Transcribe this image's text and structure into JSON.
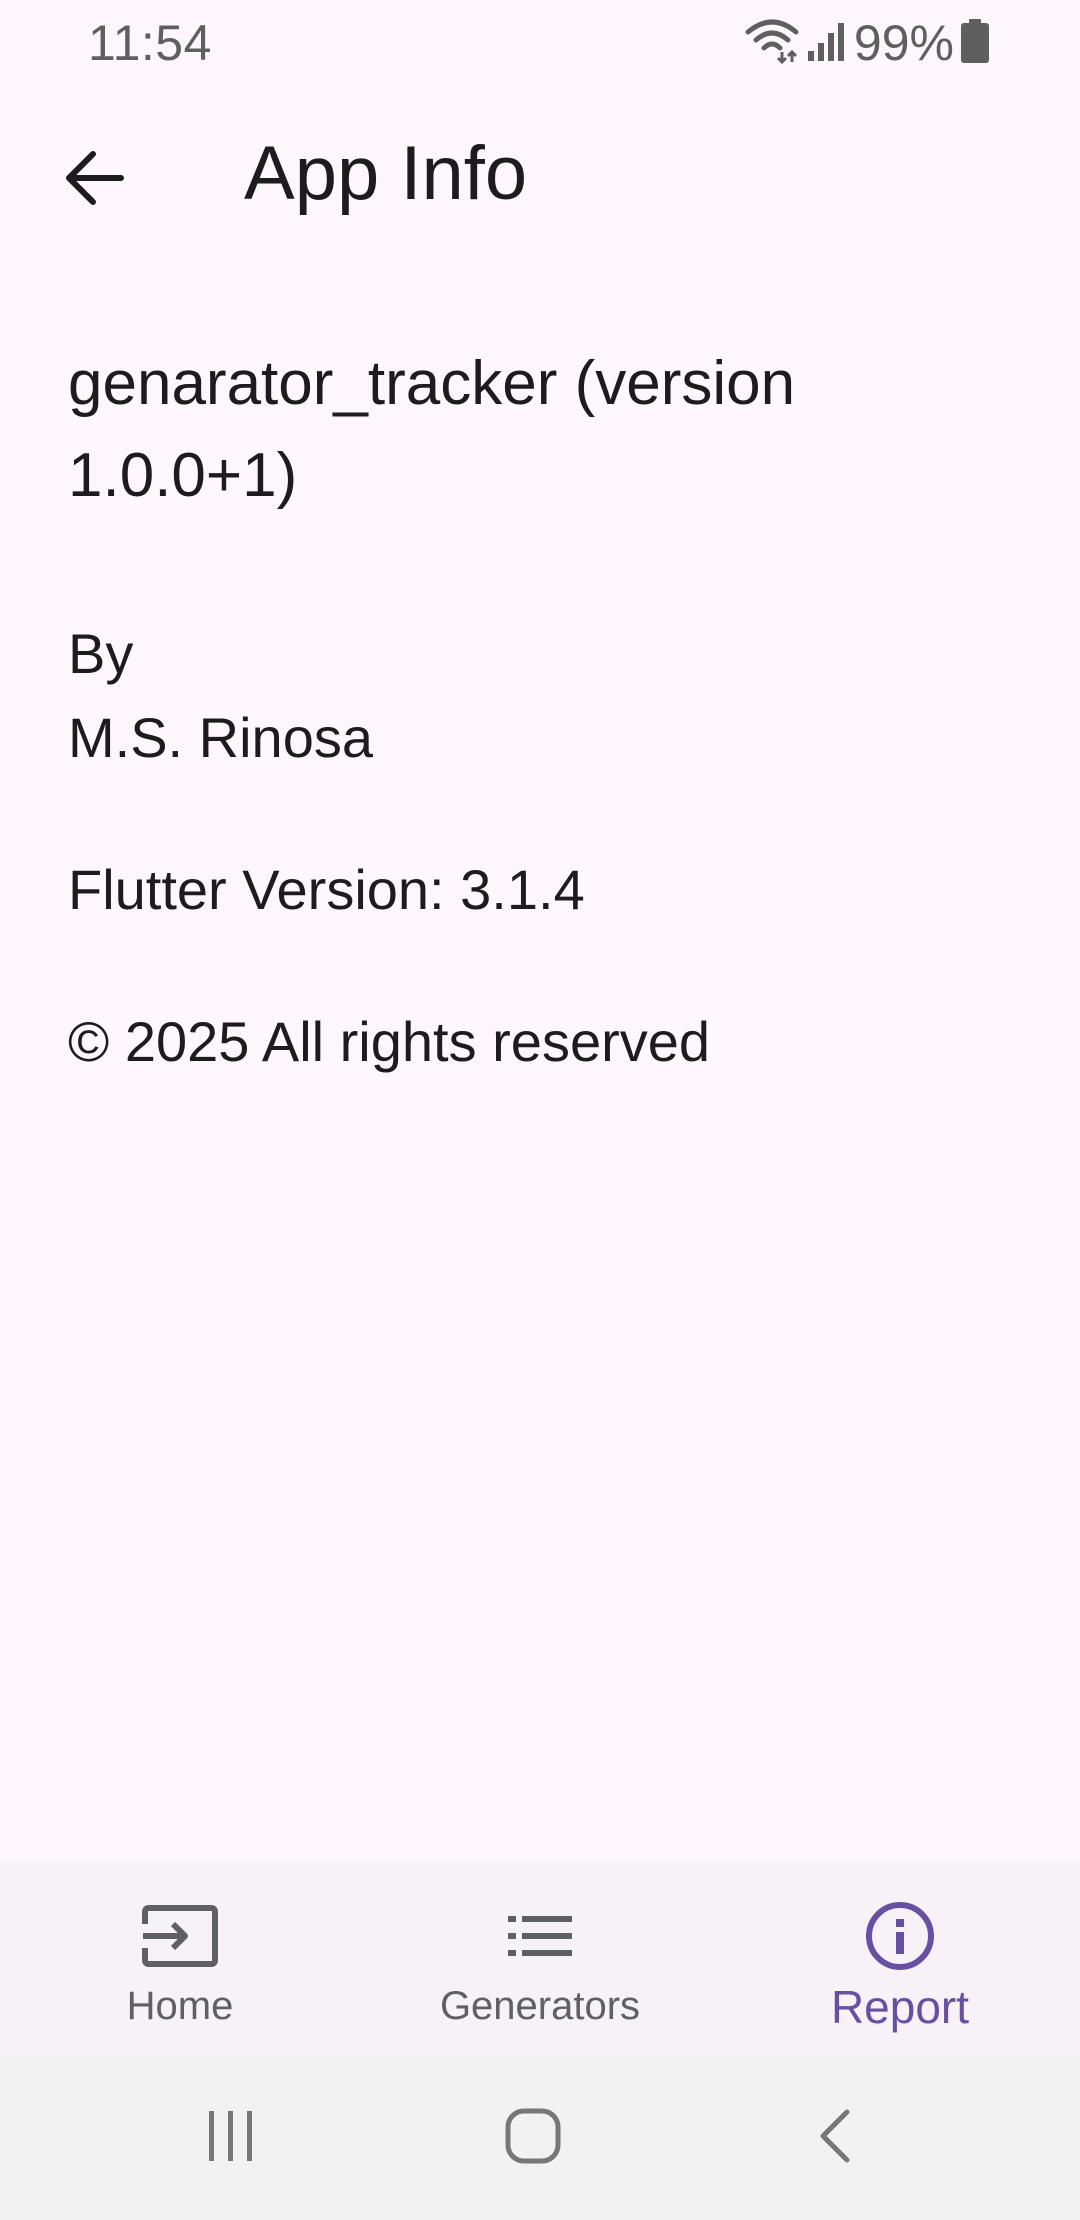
{
  "status_bar": {
    "time": "11:54",
    "battery": "99%",
    "icons": [
      "wifi-icon",
      "signal-icon",
      "battery-icon"
    ]
  },
  "app_bar": {
    "title": "App Info",
    "back_icon": "arrow-back-icon"
  },
  "content": {
    "app_name_version": "genarator_tracker (version 1.0.0+1)",
    "by_label": "By",
    "author": "M.S. Rinosa",
    "flutter_version": "Flutter Version: 3.1.4",
    "copyright": "© 2025 All rights reserved"
  },
  "bottom_nav": {
    "items": [
      {
        "label": "Home",
        "icon": "input-icon",
        "active": false
      },
      {
        "label": "Generators",
        "icon": "list-icon",
        "active": false
      },
      {
        "label": "Report",
        "icon": "info-icon",
        "active": true
      }
    ]
  },
  "system_nav": {
    "icons": [
      "recent-apps-icon",
      "home-icon",
      "back-icon"
    ]
  },
  "colors": {
    "background": "#FDF7FC",
    "text": "#1D1B20",
    "accent": "#6750A4",
    "nav_background": "#F7F1F8",
    "system_nav_background": "#F2F2F2"
  }
}
